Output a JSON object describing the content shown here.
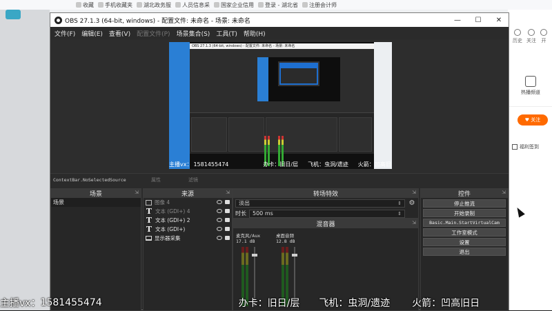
{
  "browser": {
    "bookmarks": [
      "收藏",
      "手机收藏夹",
      "湖北政务服",
      "人员信息采",
      "国家企业信用",
      "登录 - 湖北省",
      "注册会计师"
    ],
    "right_panel": {
      "top_items": [
        "历史",
        "关注",
        "开"
      ],
      "live_label": "热播频道",
      "follow_label": "关注",
      "gift_label": "福利签到"
    }
  },
  "obs": {
    "title": "OBS 27.1.3 (64-bit, windows) - 配置文件: 未命名 - 场景: 未命名",
    "window_controls": {
      "minimize": "—",
      "maximize": "☐",
      "close": "✕"
    },
    "menu": [
      "文件(F)",
      "编辑(E)",
      "查看(V)",
      "配置文件(P)",
      "场景集合(S)",
      "工具(T)",
      "帮助(H)"
    ],
    "menu_disabled_index": 3,
    "preview_overlay": {
      "host": "主播vx：",
      "number": "1581455474",
      "card": "办卡：旧日/层",
      "plane": "飞机：虫洞/遗迹",
      "rocket": "火箭：凹高旧日"
    },
    "source_bar": {
      "name": "ContextBar.NoSelectedSource",
      "properties": "属性",
      "filters": "滤镜"
    },
    "scenes": {
      "title": "场景",
      "items": [
        "场景"
      ]
    },
    "sources": {
      "title": "来源",
      "items": [
        {
          "type": "image",
          "label": "图像 4",
          "dim": true
        },
        {
          "type": "text",
          "label": "文本 (GDI+) 4",
          "dim": true
        },
        {
          "type": "text",
          "label": "文本 (GDI+) 2",
          "dim": false
        },
        {
          "type": "text",
          "label": "文本 (GDI+)",
          "dim": false
        },
        {
          "type": "display",
          "label": "显示器采集",
          "dim": false
        }
      ]
    },
    "transitions": {
      "title": "转场特效",
      "selected": "淡出",
      "duration_label": "时长",
      "duration_value": "500 ms"
    },
    "mixer": {
      "title": "混音器",
      "channels": [
        {
          "name": "麦克风/Aux",
          "db": "17.1 dB"
        },
        {
          "name": "桌面音频",
          "db": "12.8 dB"
        }
      ]
    },
    "controls": {
      "title": "控件",
      "buttons": [
        "停止推流",
        "开始录制",
        "Basic.Main.StartVirtualCam",
        "工作室模式",
        "设置",
        "退出"
      ]
    }
  },
  "bottom_overlay": {
    "host": "主播vx：",
    "number": "1581455474",
    "card": "办卡：旧日/层",
    "plane": "飞机：虫洞/遗迹",
    "rocket": "火箭：凹高旧日"
  }
}
